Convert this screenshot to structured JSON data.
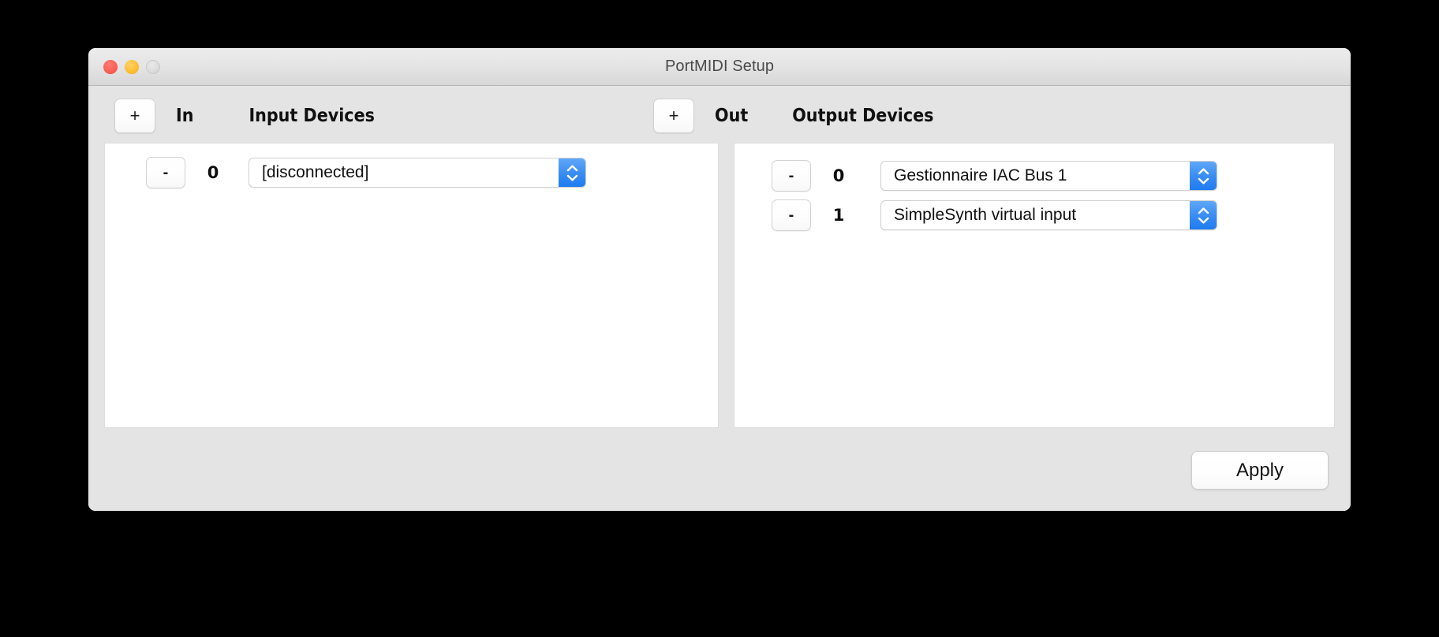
{
  "window": {
    "title": "PortMIDI Setup",
    "traffic_lights": [
      {
        "name": "close",
        "color": "#fa5e54"
      },
      {
        "name": "minimize",
        "color": "#fcbd2f"
      },
      {
        "name": "zoom",
        "color": "#dcdcdc"
      }
    ]
  },
  "colors": {
    "window_background": "#e4e4e4",
    "panel_background": "#ffffff",
    "stepper_blue": "#3b8ef4",
    "title_text": "#4a4a4a"
  },
  "input_section": {
    "add_button_label": "+",
    "direction_label": "In",
    "title": "Input Devices",
    "rows": [
      {
        "remove_button_label": "-",
        "index": "0",
        "device": "[disconnected]",
        "stepper": "up-down-stepper-icon"
      }
    ]
  },
  "output_section": {
    "add_button_label": "+",
    "direction_label": "Out",
    "title": "Output Devices",
    "rows": [
      {
        "remove_button_label": "-",
        "index": "0",
        "device": "Gestionnaire IAC Bus 1",
        "stepper": "up-down-stepper-icon"
      },
      {
        "remove_button_label": "-",
        "index": "1",
        "device": "SimpleSynth virtual input",
        "stepper": "up-down-stepper-icon"
      }
    ]
  },
  "footer": {
    "apply_label": "Apply"
  }
}
